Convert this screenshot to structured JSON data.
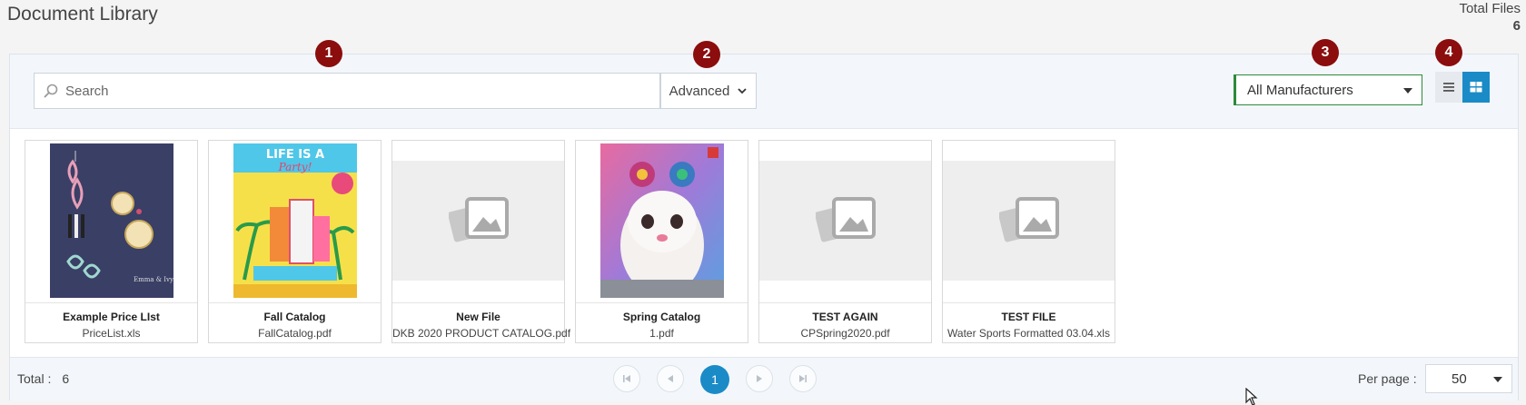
{
  "page": {
    "title": "Document Library"
  },
  "total_files": {
    "label": "Total Files",
    "count": "6"
  },
  "toolbar": {
    "search_placeholder": "Search",
    "advanced_label": "Advanced",
    "manufacturer_selected": "All Manufacturers",
    "markers": [
      "1",
      "2",
      "3",
      "4"
    ]
  },
  "documents": [
    {
      "title": "Example Price LIst",
      "file": "PriceList.xls",
      "thumb": "earrings-catalog-cover"
    },
    {
      "title": "Fall Catalog",
      "file": "FallCatalog.pdf",
      "thumb": "party-catalog-cover",
      "cover_text": "LIFE IS A",
      "cover_text2": "Party!"
    },
    {
      "title": "New File",
      "file": "DKB 2020 PRODUCT CATALOG.pdf",
      "thumb": "placeholder-image-icon"
    },
    {
      "title": "Spring Catalog",
      "file": "1.pdf",
      "thumb": "plush-catalog-cover"
    },
    {
      "title": "TEST AGAIN",
      "file": "CPSpring2020.pdf",
      "thumb": "placeholder-image-icon"
    },
    {
      "title": "TEST FILE",
      "file": "Water Sports Formatted 03.04.xls",
      "thumb": "placeholder-image-icon"
    }
  ],
  "footer": {
    "total_label": "Total :",
    "total_value": "6",
    "current_page": "1",
    "per_page_label": "Per page :",
    "per_page_value": "50"
  },
  "colors": {
    "accent": "#1a8bc7",
    "marker": "#8b0d0d",
    "select_border": "#2c8a3a"
  }
}
